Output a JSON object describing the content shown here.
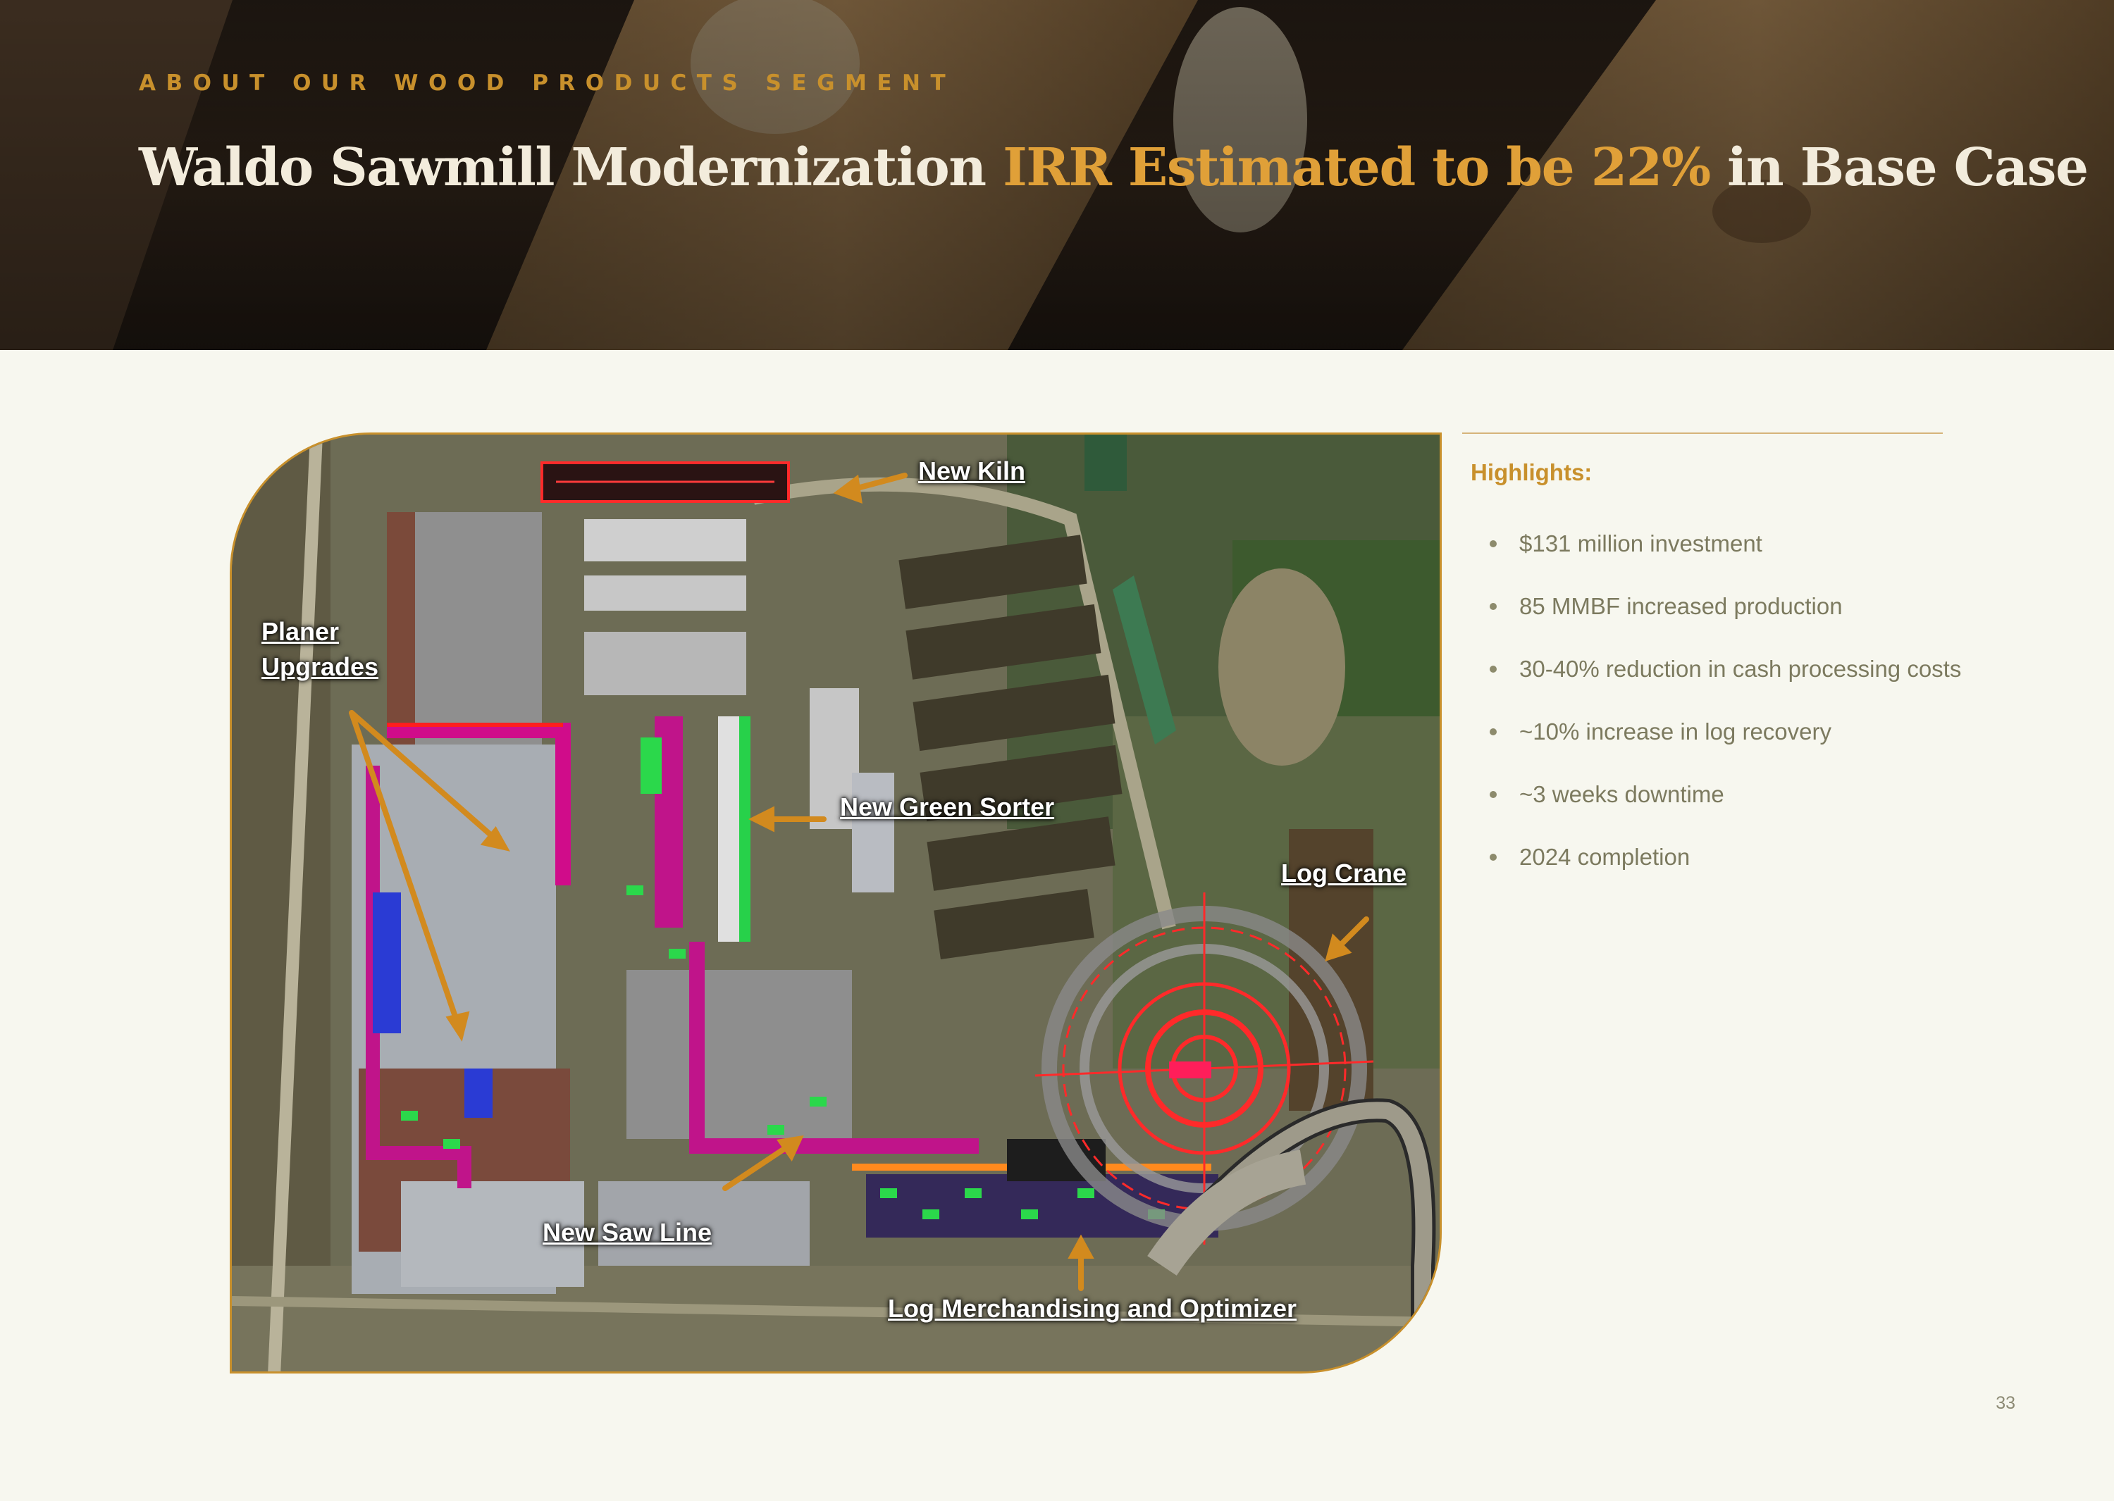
{
  "header": {
    "kicker": "ABOUT OUR WOOD PRODUCTS SEGMENT",
    "title_part1": "Waldo Sawmill Modernization ",
    "title_highlight": "IRR Estimated to be 22%",
    "title_part2": " in Base Case"
  },
  "map": {
    "callouts": {
      "new_kiln": "New Kiln",
      "planer_line1": "Planer",
      "planer_line2": "Upgrades",
      "new_green_sorter": "New Green Sorter",
      "log_crane": "Log Crane",
      "new_saw_line": "New Saw Line",
      "log_merchandising": "Log Merchandising and Optimizer"
    }
  },
  "highlights": {
    "title": "Highlights:",
    "items": [
      "$131 million investment",
      "85 MMBF increased production",
      "30-40% reduction in cash processing costs",
      "~10% increase in log recovery",
      "~3 weeks downtime",
      "2024 completion"
    ]
  },
  "page_number": "33",
  "colors": {
    "accent": "#c8902c",
    "background": "#f7f7ef",
    "bullet_text": "#7c7a5f",
    "title_text": "#f3ecdc"
  }
}
